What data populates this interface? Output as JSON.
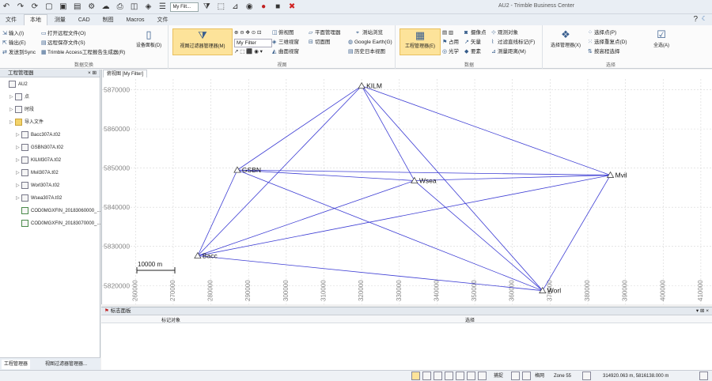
{
  "window": {
    "title": "AU2 - Trimble Business Center",
    "filter_value": "My Filt..."
  },
  "tabs": [
    "文件",
    "本地",
    "测量",
    "CAD",
    "制图",
    "Macros",
    "文件"
  ],
  "active_tab": "本地",
  "ribbon": {
    "data_exchange": {
      "items": [
        "输入(I)",
        "输出(E)",
        "发送到Sync",
        "打开远程文件(O)",
        "远程保存文件(S)",
        "Trimble Access工程报告生成器(R)"
      ],
      "big_button": "设备面板(D)",
      "label": "数据交换"
    },
    "view": {
      "big_button": "视图过滤器管理器(M)",
      "filter": "My Filter",
      "items": [
        "俯视图",
        "三维视窗",
        "曲面视窗",
        "平面管理器",
        "切面图",
        "测站浏览",
        "Google Earth(G)",
        "历史日本视图"
      ],
      "label": "视图"
    },
    "data": {
      "big_button": "工程管理器(E)",
      "items": [
        "占用",
        "光学",
        "摄像点",
        "矢量",
        "观测对象",
        "要素",
        "过滤直线标记(F)",
        "测量距离(M)"
      ],
      "label": "数据"
    },
    "select": {
      "big_button": "选择管理器(X)",
      "items": [
        "选择点(P)",
        "选择重复点(D)",
        "按高程选择"
      ],
      "all_button": "全选(A)",
      "label": "选择"
    }
  },
  "project_panel": {
    "title": "工程管理器",
    "tree": [
      {
        "label": "AU2",
        "level": 0
      },
      {
        "label": "点",
        "level": 1
      },
      {
        "label": "时段",
        "level": 1
      },
      {
        "label": "导入文件",
        "level": 1
      },
      {
        "label": "Bacc307A.t02",
        "level": 2
      },
      {
        "label": "GSBN307A.t02",
        "level": 2
      },
      {
        "label": "KILM307A.t02",
        "level": 2
      },
      {
        "label": "Mvil307A.t02",
        "level": 2
      },
      {
        "label": "Worl307A.t02",
        "level": 2
      },
      {
        "label": "Wsea307A.t02",
        "level": 2
      },
      {
        "label": "COD0MGXFIN_20183060000_...",
        "level": 2
      },
      {
        "label": "COD0MGXFIN_20183070000_...",
        "level": 2
      }
    ],
    "bottom_tabs": [
      "工程管理器",
      "视图过滤器管理器..."
    ]
  },
  "map": {
    "tab_label": "俯视图 [My Filter]",
    "y_ticks": [
      "5870000",
      "5860000",
      "5850000",
      "5840000",
      "5830000",
      "5820000"
    ],
    "x_ticks": [
      "260000",
      "270000",
      "280000",
      "290000",
      "300000",
      "310000",
      "320000",
      "330000",
      "340000",
      "350000",
      "360000",
      "370000",
      "380000",
      "390000",
      "400000",
      "410000"
    ],
    "scale_label": "10000 m",
    "stations": [
      {
        "name": "KILM",
        "e": 320000,
        "n": 5871000
      },
      {
        "name": "GSBN",
        "e": 287000,
        "n": 5849500
      },
      {
        "name": "Wsea",
        "e": 334000,
        "n": 5846800
      },
      {
        "name": "Mvil",
        "e": 386000,
        "n": 5848200
      },
      {
        "name": "Bacc",
        "e": 276500,
        "n": 5827600
      },
      {
        "name": "Worl",
        "e": 368000,
        "n": 5818700
      }
    ],
    "baselines": [
      [
        "KILM",
        "GSBN"
      ],
      [
        "KILM",
        "Bacc"
      ],
      [
        "KILM",
        "Mvil"
      ],
      [
        "KILM",
        "Wsea"
      ],
      [
        "KILM",
        "Worl"
      ],
      [
        "GSBN",
        "Mvil"
      ],
      [
        "GSBN",
        "Wsea"
      ],
      [
        "GSBN",
        "Worl"
      ],
      [
        "GSBN",
        "Bacc"
      ],
      [
        "Bacc",
        "Wsea"
      ],
      [
        "Bacc",
        "Mvil"
      ],
      [
        "Bacc",
        "Worl"
      ],
      [
        "Wsea",
        "Mvil"
      ],
      [
        "Wsea",
        "Worl"
      ],
      [
        "Mvil",
        "Worl"
      ]
    ],
    "colors": {
      "line": "#3d3dd4",
      "station": "#444444",
      "grid": "#d6d6d6"
    }
  },
  "flags_panel": {
    "title": "标志面板",
    "col1": "标记对象",
    "col2": "选择"
  },
  "statusbar": {
    "snap": "捕捉",
    "grid": "格网",
    "zone": "Zone 55",
    "coords": "314920.063 m, 5816138.000 m"
  }
}
